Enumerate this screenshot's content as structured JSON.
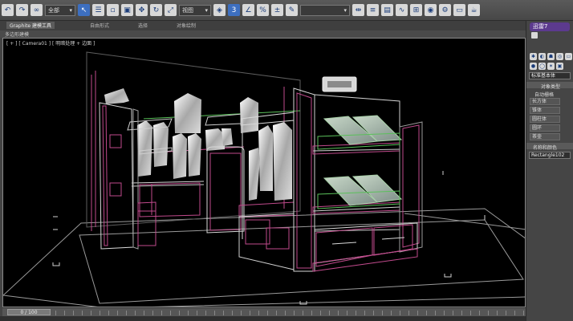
{
  "toolbar": {
    "selection_filter": "全部",
    "view_label": "视图",
    "selection_set": "",
    "icons": [
      "undo-icon",
      "redo-icon",
      "link-icon",
      "select-icon",
      "select-by-name-icon",
      "move-icon",
      "rotate-icon",
      "scale-icon",
      "snap-icon",
      "angle-snap-icon",
      "mirror-icon",
      "align-icon",
      "curve-editor-icon",
      "material-editor-icon",
      "render-setup-icon",
      "render-icon",
      "render-frame-icon"
    ]
  },
  "ribbon": {
    "tabs": [
      "Graphite 建模工具",
      "自由形式",
      "选择",
      "对象绘制"
    ],
    "active_tab": "Graphite 建模工具",
    "sub_label": "多边形建模"
  },
  "viewport": {
    "label": "[ + ] [ Camera01 ] [ 明暗处理 + 边面 ]"
  },
  "timeline": {
    "frame": "0 / 100"
  },
  "command_panel": {
    "brand": "迅雷7",
    "section_title": "标准基本体",
    "rollout_title": "对象类型",
    "autogrid": "自动栅格",
    "buttons": [
      "长方体",
      "锥体",
      "圆柱体",
      "圆环",
      "茶壶"
    ],
    "name_rollout": "名称和颜色",
    "object_name": "Rectangle102"
  },
  "colors": {
    "accent": "#5c3a8e",
    "viewport_bg": "#000000",
    "wire_magenta": "#c04a8c",
    "wire_green": "#5ac05a"
  }
}
